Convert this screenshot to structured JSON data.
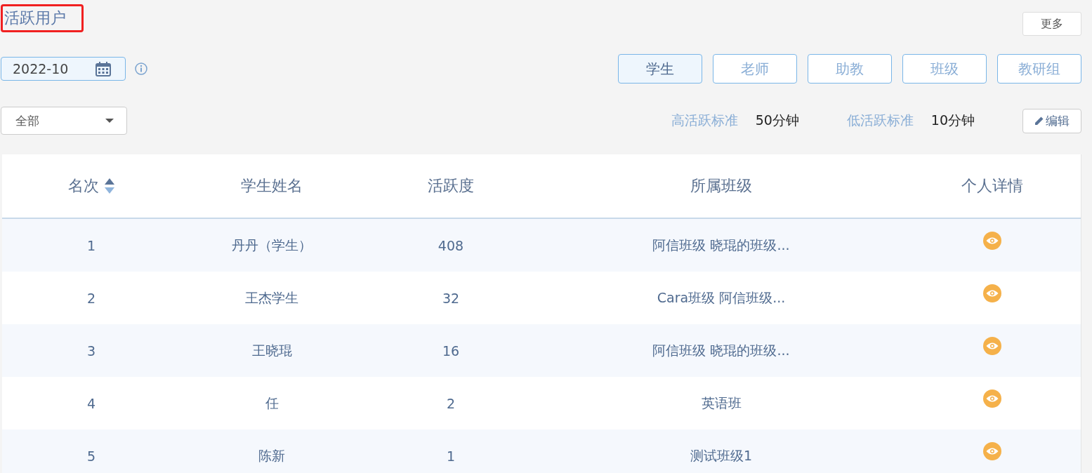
{
  "title": "活跃用户",
  "more_button": "更多",
  "month_picker": {
    "value": "2022-10"
  },
  "tabs": [
    {
      "label": "学生",
      "selected": true
    },
    {
      "label": "老师",
      "selected": false
    },
    {
      "label": "助教",
      "selected": false
    },
    {
      "label": "班级",
      "selected": false
    },
    {
      "label": "教研组",
      "selected": false
    }
  ],
  "filter_select": {
    "value": "全部"
  },
  "standards": [
    {
      "label": "高活跃标准",
      "value": "50分钟"
    },
    {
      "label": "低活跃标准",
      "value": "10分钟"
    }
  ],
  "edit_button": "编辑",
  "table": {
    "columns": [
      "名次",
      "学生姓名",
      "活跃度",
      "所属班级",
      "个人详情"
    ],
    "rows": [
      {
        "rank": "1",
        "name": "丹丹（学生）",
        "activity": "408",
        "classes": "阿信班级 晓琨的班级..."
      },
      {
        "rank": "2",
        "name": "王杰学生",
        "activity": "32",
        "classes": "Cara班级 阿信班级..."
      },
      {
        "rank": "3",
        "name": "王晓琨",
        "activity": "16",
        "classes": "阿信班级 晓琨的班级..."
      },
      {
        "rank": "4",
        "name": "任",
        "activity": "2",
        "classes": "英语班"
      },
      {
        "rank": "5",
        "name": "陈新",
        "activity": "1",
        "classes": "测试班级1"
      }
    ]
  }
}
